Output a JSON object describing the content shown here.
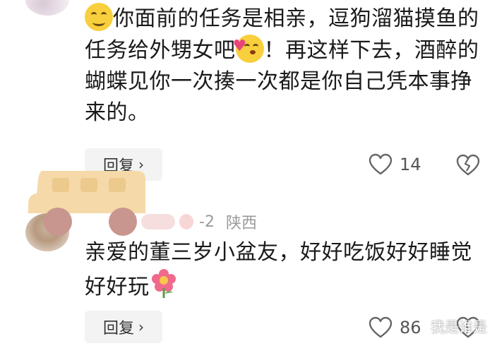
{
  "comments": [
    {
      "text_parts": [
        "你面前的任务是相亲，逗狗溜猫摸鱼的任务给外甥女吧",
        "！再这样下去，酒醉的蝴蝶见你一次揍一次都是你自己凭本事挣来的。"
      ],
      "reply_label": "回复",
      "likes": "14"
    },
    {
      "meta_date": "-2",
      "meta_location": "陕西",
      "text": "亲爱的董三岁小盆友，好好吃饭好好睡觉好好玩",
      "reply_label": "回复",
      "likes": "86"
    }
  ],
  "watermark": "我是谁是",
  "colors": {
    "heart_outline": "#666666",
    "car_body": "#f5d9a8",
    "car_wheel": "#c9968f"
  },
  "icons": [
    "smiling-emoji-icon",
    "kissing-heart-emoji-icon",
    "flower-emoji-icon",
    "heart-like-icon",
    "broken-heart-icon",
    "chevron-right-icon"
  ]
}
